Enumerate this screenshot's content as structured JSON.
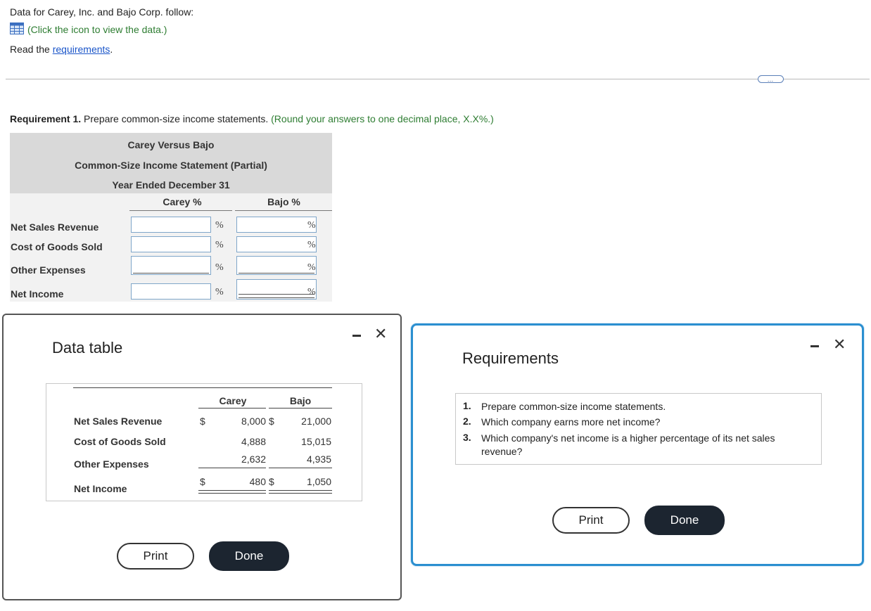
{
  "intro": {
    "text": "Data for Carey, Inc. and Bajo Corp. follow:",
    "view_data": "(Click the icon to view the data.)",
    "read_prefix": "Read the ",
    "read_link": "requirements",
    "read_suffix": "."
  },
  "more_button": "…",
  "requirement1": {
    "label": "Requirement 1.",
    "text": " Prepare common-size income statements.",
    "hint": " (Round your answers to one decimal place, X.X%.)"
  },
  "statement": {
    "title": "Carey Versus Bajo",
    "subtitle": "Common-Size Income Statement (Partial)",
    "period": "Year Ended December 31",
    "col_carey": "Carey %",
    "col_bajo": "Bajo %",
    "pct_symbol": "%",
    "rows": [
      {
        "label": "Net Sales Revenue",
        "carey": "",
        "bajo": ""
      },
      {
        "label": "Cost of Goods Sold",
        "carey": "",
        "bajo": ""
      },
      {
        "label": "Other Expenses",
        "carey": "",
        "bajo": ""
      },
      {
        "label": "Net Income",
        "carey": "",
        "bajo": ""
      }
    ]
  },
  "data_dialog": {
    "title": "Data table",
    "col_carey": "Carey",
    "col_bajo": "Bajo",
    "currency": "$",
    "rows": [
      {
        "label": "Net Sales Revenue",
        "carey": "8,000",
        "bajo": "21,000"
      },
      {
        "label": "Cost of Goods Sold",
        "carey": "4,888",
        "bajo": "15,015"
      },
      {
        "label": "Other Expenses",
        "carey": "2,632",
        "bajo": "4,935"
      },
      {
        "label": "Net Income",
        "carey": "480",
        "bajo": "1,050"
      }
    ],
    "print": "Print",
    "done": "Done"
  },
  "req_dialog": {
    "title": "Requirements",
    "items": [
      {
        "num": "1.",
        "text": "Prepare common-size income statements."
      },
      {
        "num": "2.",
        "text": "Which company earns more net income?"
      },
      {
        "num": "3.",
        "text": "Which company's net income is a higher percentage of its net sales revenue?"
      }
    ],
    "print": "Print",
    "done": "Done"
  },
  "colors": {
    "hint_green": "#2e7d32",
    "link_blue": "#1a55c9",
    "dialog_border_blue": "#2b8fd0",
    "done_button": "#1c2530"
  }
}
